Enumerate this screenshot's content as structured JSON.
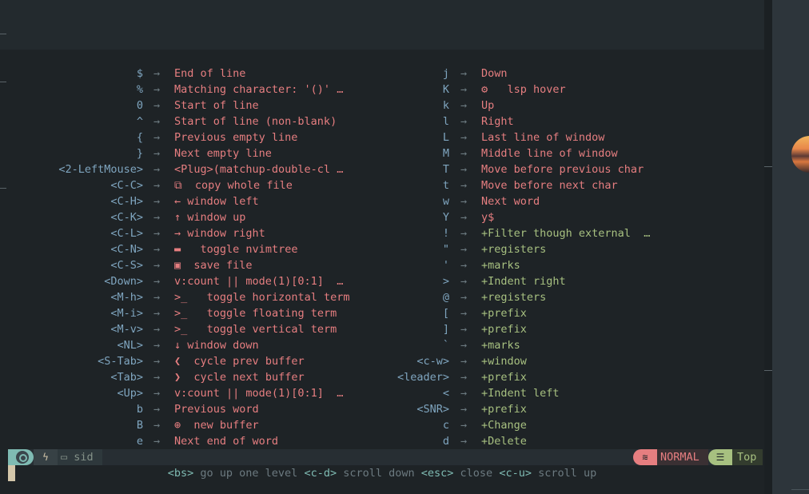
{
  "left_mappings": [
    {
      "key": "$",
      "desc": "End of line"
    },
    {
      "key": "%",
      "desc": "Matching character: '()' …"
    },
    {
      "key": "0",
      "desc": "Start of line"
    },
    {
      "key": "^",
      "desc": "Start of line (non-blank)"
    },
    {
      "key": "{",
      "desc": "Previous empty line"
    },
    {
      "key": "}",
      "desc": "Next empty line"
    },
    {
      "key": "<2-LeftMouse>",
      "desc": "<Plug>(matchup-double-cl …"
    },
    {
      "key": "<C-C>",
      "icon": "⧉",
      "desc": " copy whole file"
    },
    {
      "key": "<C-H>",
      "icon": "←",
      "desc": "window left"
    },
    {
      "key": "<C-K>",
      "icon": "↑",
      "desc": "window up"
    },
    {
      "key": "<C-L>",
      "icon": "→",
      "desc": "window right"
    },
    {
      "key": "<C-N>",
      "icon": "▬",
      "desc": "  toggle nvimtree"
    },
    {
      "key": "<C-S>",
      "icon": "▣",
      "desc": " save file"
    },
    {
      "key": "<Down>",
      "desc": "v:count || mode(1)[0:1]  …"
    },
    {
      "key": "<M-h>",
      "icon": ">_",
      "desc": "  toggle horizontal term"
    },
    {
      "key": "<M-i>",
      "icon": ">_",
      "desc": "  toggle floating term"
    },
    {
      "key": "<M-v>",
      "icon": ">_",
      "desc": "  toggle vertical term"
    },
    {
      "key": "<NL>",
      "icon": "↓",
      "desc": "window down"
    },
    {
      "key": "<S-Tab>",
      "icon": "❮",
      "desc": " cycle prev buffer"
    },
    {
      "key": "<Tab>",
      "icon": "❯",
      "desc": " cycle next buffer"
    },
    {
      "key": "<Up>",
      "desc": "v:count || mode(1)[0:1]  …"
    },
    {
      "key": "b",
      "desc": "Previous word"
    },
    {
      "key": "B",
      "icon": "⊕",
      "desc": " new buffer"
    },
    {
      "key": "e",
      "desc": "Next end of word"
    }
  ],
  "right_mappings": [
    {
      "key": "j",
      "desc": "Down",
      "group": false
    },
    {
      "key": "K",
      "icon": "⚙",
      "desc": "  lsp hover",
      "group": false
    },
    {
      "key": "k",
      "desc": "Up",
      "group": false
    },
    {
      "key": "l",
      "desc": "Right",
      "group": false
    },
    {
      "key": "L",
      "desc": "Last line of window",
      "group": false
    },
    {
      "key": "M",
      "desc": "Middle line of window",
      "group": false
    },
    {
      "key": "T",
      "desc": "Move before previous char",
      "group": false
    },
    {
      "key": "t",
      "desc": "Move before next char",
      "group": false
    },
    {
      "key": "w",
      "desc": "Next word",
      "group": false
    },
    {
      "key": "Y",
      "desc": "y$",
      "group": false
    },
    {
      "key": "!",
      "desc": "+Filter though external  …",
      "group": true
    },
    {
      "key": "\"",
      "desc": "+registers",
      "group": true
    },
    {
      "key": "'",
      "desc": "+marks",
      "group": true
    },
    {
      "key": ">",
      "desc": "+Indent right",
      "group": true
    },
    {
      "key": "@",
      "desc": "+registers",
      "group": true
    },
    {
      "key": "[",
      "desc": "+prefix",
      "group": true
    },
    {
      "key": "]",
      "desc": "+prefix",
      "group": true
    },
    {
      "key": "`",
      "desc": "+marks",
      "group": true
    },
    {
      "key": "<c-w>",
      "desc": "+window",
      "group": true
    },
    {
      "key": "<leader>",
      "desc": "+prefix",
      "group": true
    },
    {
      "key": "<",
      "desc": "+Indent left",
      "group": true
    },
    {
      "key": "<SNR>",
      "desc": "+prefix",
      "group": true
    },
    {
      "key": "c",
      "desc": "+Change",
      "group": true
    },
    {
      "key": "d",
      "desc": "+Delete",
      "group": true
    }
  ],
  "arrow": "→",
  "statusline": {
    "left_icon": "ϟ",
    "folder": "sid",
    "mode_icon": "≋",
    "mode": "NORMAL",
    "pos_icon": "☰",
    "position": "Top"
  },
  "help": [
    {
      "key": "<bs>",
      "text": "go up one level"
    },
    {
      "key": "<c-d>",
      "text": "scroll down"
    },
    {
      "key": "<esc>",
      "text": "close"
    },
    {
      "key": "<c-u>",
      "text": "scroll up"
    }
  ],
  "colors": {
    "background": "#1e2326",
    "key": "#7fa5bf",
    "desc": "#e67e80",
    "group": "#a7c080",
    "arrow": "#6c7a80"
  }
}
